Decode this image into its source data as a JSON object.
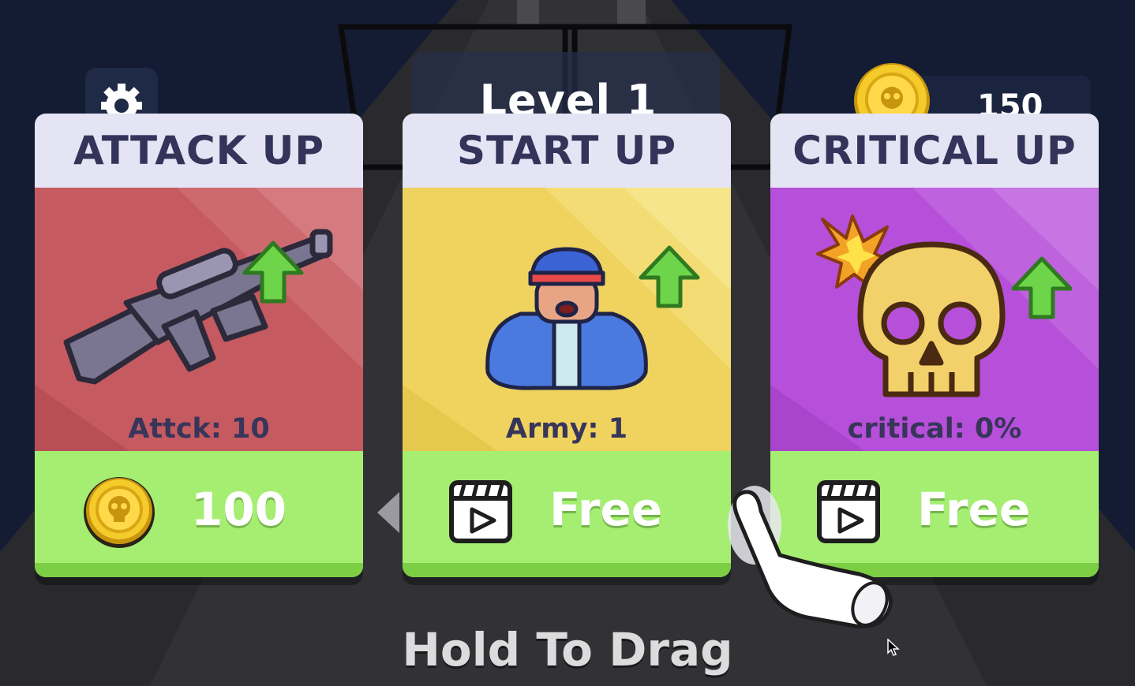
{
  "hud": {
    "level_label": "Level 1",
    "coin_count": "150",
    "settings_icon": "gear-icon",
    "coin_icon": "skull-coin-icon"
  },
  "cards": [
    {
      "title": "ATTACK UP",
      "stat": "Attck: 10",
      "price": "100",
      "price_icon": "skull-coin-icon",
      "art_icon": "rifle-icon",
      "color": "#c55a60"
    },
    {
      "title": "START UP",
      "stat": "Army: 1",
      "price": "Free",
      "price_icon": "video-ad-icon",
      "art_icon": "soldier-icon",
      "color": "#efd35e"
    },
    {
      "title": "CRITICAL UP",
      "stat": "critical: 0%",
      "price": "Free",
      "price_icon": "video-ad-icon",
      "art_icon": "skull-icon",
      "color": "#b64fd9"
    }
  ],
  "hint": "Hold To Drag",
  "colors": {
    "title_text": "#34335a",
    "footer_green": "#a5ee72",
    "background": "#141c33"
  }
}
